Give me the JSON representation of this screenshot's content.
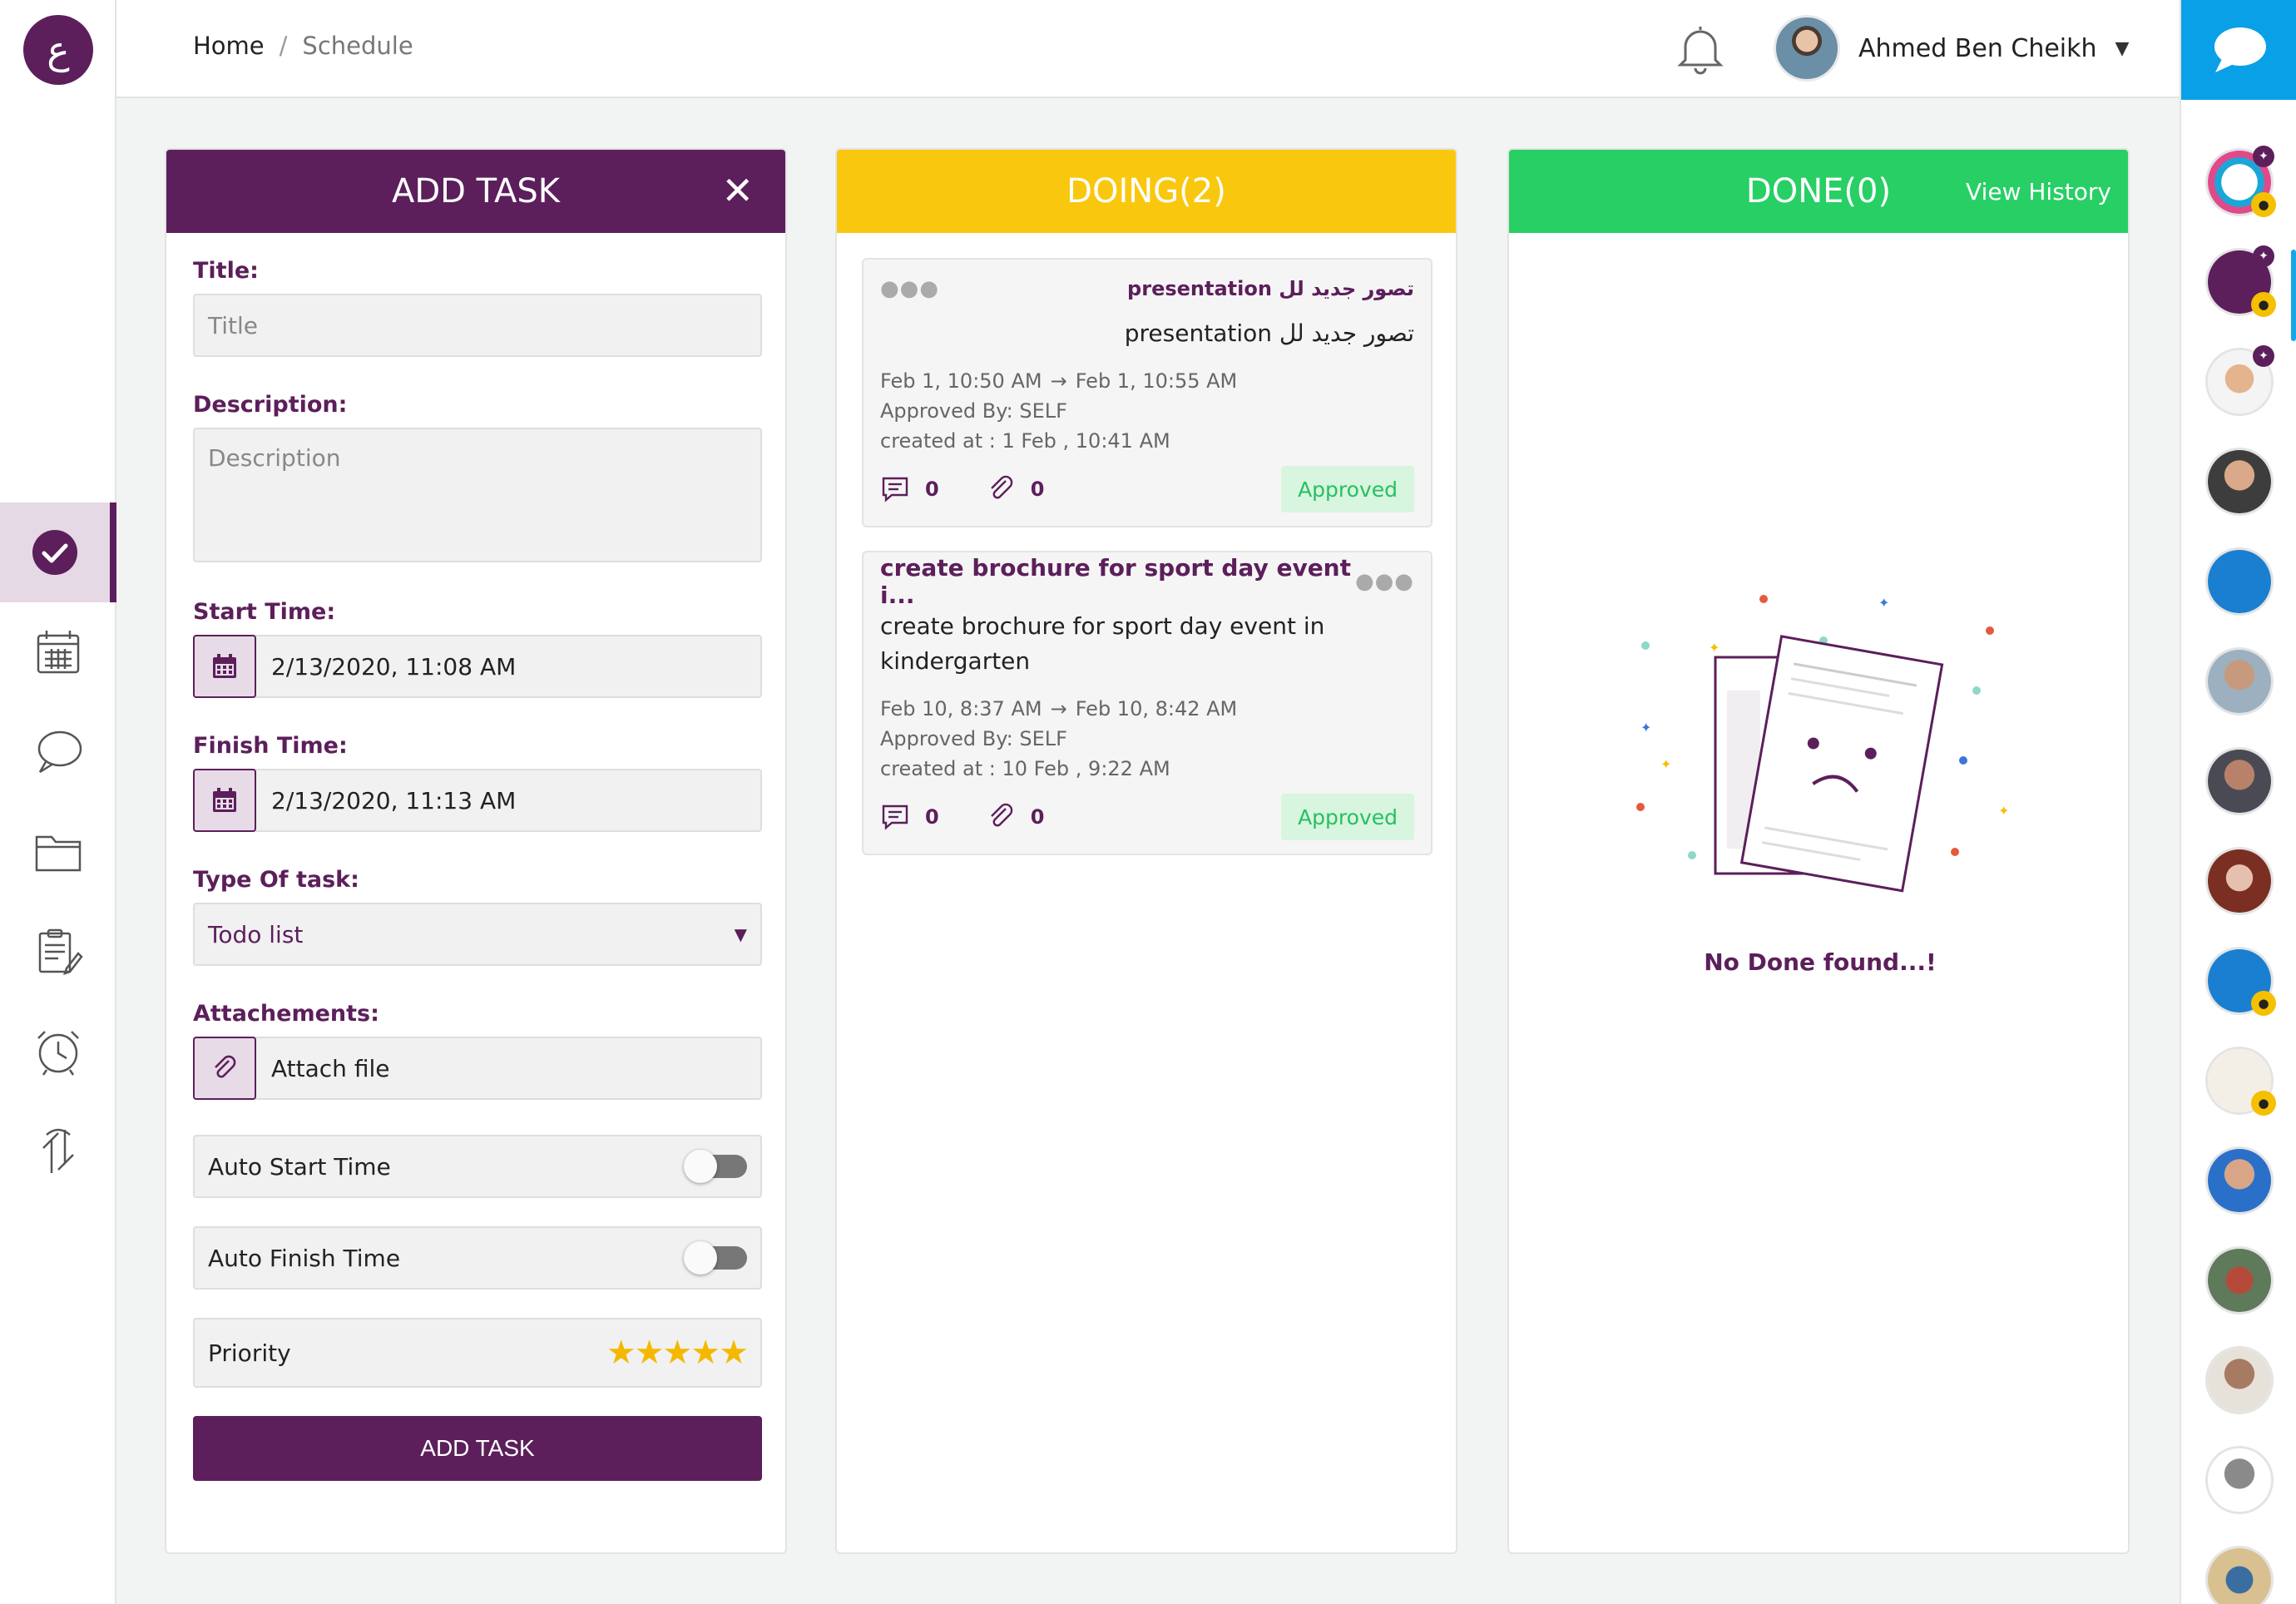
{
  "breadcrumb": {
    "home": "Home",
    "separator": "/",
    "current": "Schedule"
  },
  "user": {
    "name": "Ahmed Ben Cheikh"
  },
  "logo_glyph": "ع",
  "columns": {
    "add": {
      "title": "ADD TASK",
      "close": "✕",
      "fields": {
        "title_label": "Title:",
        "title_placeholder": "Title",
        "description_label": "Description:",
        "description_placeholder": "Description",
        "start_label": "Start Time:",
        "start_value": "2/13/2020, 11:08 AM",
        "finish_label": "Finish Time:",
        "finish_value": "2/13/2020, 11:13 AM",
        "type_label": "Type Of task:",
        "type_value": "Todo list",
        "attach_label": "Attachements:",
        "attach_value": "Attach file",
        "auto_start": "Auto Start Time",
        "auto_finish": "Auto Finish Time",
        "priority": "Priority",
        "priority_stars": "★★★★★"
      },
      "submit": "ADD TASK"
    },
    "doing": {
      "title": "DOING(2)",
      "tasks": [
        {
          "title": "تصور جديد لل presentation",
          "description": "تصور جديد لل presentation",
          "start": "Feb 1, 10:50 AM",
          "arrow": "→",
          "end": "Feb 1, 10:55 AM",
          "approved_by": "Approved By: SELF",
          "created_at": "created at : 1 Feb , 10:41 AM",
          "comments": "0",
          "attachments": "0",
          "status": "Approved"
        },
        {
          "title": "create brochure for sport day event i...",
          "description": "create brochure for sport day event in kindergarten",
          "start": "Feb 10, 8:37 AM",
          "arrow": "→",
          "end": "Feb 10, 8:42 AM",
          "approved_by": "Approved By: SELF",
          "created_at": "created at : 10 Feb , 9:22 AM",
          "comments": "0",
          "attachments": "0",
          "status": "Approved"
        }
      ]
    },
    "done": {
      "title": "DONE(0)",
      "view_history": "View History",
      "empty": "No Done found...!"
    }
  },
  "colors": {
    "brand_purple": "#5c1f5b",
    "doing_yellow": "#f9c80e",
    "done_green": "#27cf65",
    "chat_blue": "#0aa0e8",
    "approved_bg": "#d7f5df",
    "approved_text": "#27c060",
    "star": "#f5b800"
  },
  "sidebar_icons": [
    "tasks-check-icon",
    "calendar-icon",
    "chat-bubble-icon",
    "folder-icon",
    "clipboard-edit-icon",
    "alarm-clock-icon",
    "sync-arrows-icon"
  ]
}
